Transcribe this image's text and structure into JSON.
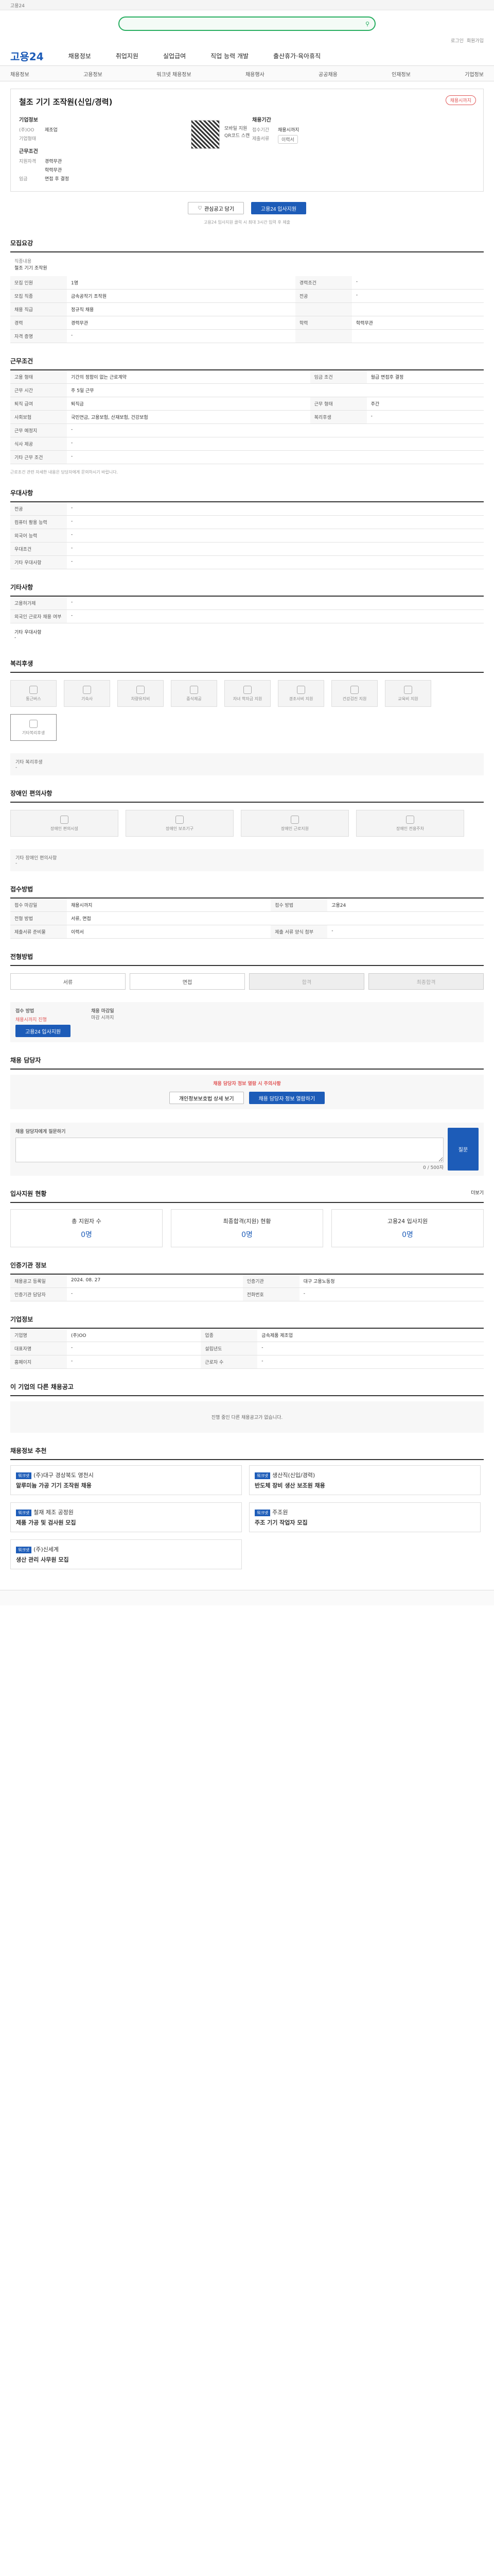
{
  "topbar": {
    "text": "고용24"
  },
  "search": {
    "placeholder": "",
    "label": "검색"
  },
  "userlinks": [
    "로그인",
    "회원가입"
  ],
  "gnb": {
    "logo": "고용24",
    "menus": [
      "채용정보",
      "취업지원",
      "실업급여",
      "직업 능력 개발",
      "출산휴가·육아휴직"
    ]
  },
  "lnb": [
    "채용정보",
    "고용정보",
    "워크넷 채용정보",
    "채용행사",
    "공공채용",
    "인재정보",
    "기업정보"
  ],
  "job": {
    "title": "철조 기기 조작원(신입/경력)",
    "badge": "채용시까지",
    "company_label": "기업정보",
    "company": [
      "(주)OO",
      "제조업",
      "기업형태"
    ],
    "cond_label": "근무조건",
    "cond": [
      "지원자격",
      "경력무관",
      "학력무관"
    ],
    "cond2": [
      "임금",
      "면접 후 결정",
      "근무지역"
    ],
    "qr_text": [
      "모바일 지원",
      "QR코드 스캔"
    ],
    "period_label": "채용기간",
    "period": [
      "접수기간",
      "채용시까지"
    ],
    "submit": [
      "제출서류",
      "이력서"
    ],
    "btn_interest": "관심공고 담기",
    "btn_apply": "고용24 입사지원",
    "notice": "고용24 입사지원 클릭 시 최대 3시간 입력 후 제출"
  },
  "qual": {
    "title": "모집요강",
    "label": "직종내용",
    "value": "철조 기기 조작원",
    "rows": [
      [
        "모집 인원",
        "1명",
        "경력조건",
        "-"
      ],
      [
        "모집 직종",
        "금속공작기 조작원",
        "전공",
        "-"
      ],
      [
        "채용 직급",
        "정규직 채용",
        "",
        ""
      ],
      [
        "경력",
        "경력무관",
        "학력",
        "학력무관"
      ],
      [
        "자격 증명",
        "-",
        "",
        ""
      ]
    ]
  },
  "cond": {
    "title": "근무조건",
    "rows": [
      [
        "고용 형태",
        "기간의 정함이 없는 근로계약",
        "임금 조건",
        "월급 면접후 결정"
      ],
      [
        "근무 시간",
        "주 5일 근무",
        "",
        ""
      ],
      [
        "퇴직 급여",
        "퇴직금",
        "근무 형태",
        "주간"
      ],
      [
        "사회보험",
        "국민연금, 고용보험, 산재보험, 건강보험",
        "복리후생",
        "-"
      ],
      [
        "근무 예정지",
        "-",
        "",
        ""
      ],
      [
        "식사 제공",
        "-",
        "",
        ""
      ],
      [
        "기타 근무 조건",
        "-",
        "",
        ""
      ]
    ],
    "note": "근로조건 관련 자세한 내용은 담당자에게 문의하시기 바랍니다."
  },
  "pref": {
    "title": "우대사항",
    "rows": [
      [
        "전공",
        "-"
      ],
      [
        "컴퓨터 활용 능력",
        "-"
      ],
      [
        "외국어 능력",
        "-"
      ],
      [
        "우대조건",
        "-"
      ],
      [
        "기타 우대사항",
        "-"
      ]
    ]
  },
  "etc": {
    "title": "기타사항",
    "rows": [
      [
        "고용허가제",
        "-"
      ],
      [
        "외국인 근로자 채용 여부",
        "-"
      ]
    ],
    "extra_label": "기타 우대사항",
    "extra_value": "-"
  },
  "welfare": {
    "title": "복리후생",
    "items": [
      "통근버스",
      "기숙사",
      "차량유지비",
      "중식제공",
      "자녀 학자금 지원",
      "경조사비 지원",
      "건강검진 지원",
      "교육비 지원",
      "기타복리후생"
    ],
    "extra_label": "기타 복리후생",
    "extra_value": "-"
  },
  "disab": {
    "title": "장애인 편의사항",
    "items": [
      "장애인 편의시설",
      "장애인 보조기구",
      "장애인 근로지원",
      "장애인 전용주차"
    ],
    "extra_label": "기타 장애인 편의사항",
    "extra_value": "-"
  },
  "apply": {
    "title": "접수방법",
    "rows": [
      [
        "접수 마감일",
        "채용시까지",
        "접수 방법",
        "고용24"
      ],
      [
        "전형 방법",
        "서류, 면접",
        "",
        ""
      ],
      [
        "제출서류 준비물",
        "이력서",
        "제출 서류 양식 첨부",
        "-"
      ]
    ]
  },
  "process": {
    "title": "전형방법",
    "steps": [
      "서류",
      "면접",
      "합격",
      "최종합격"
    ]
  },
  "reception": {
    "title": "접수 방법",
    "label": "채용시까지 진행",
    "btn": "고용24 입사지원",
    "label2": "채용 마감일",
    "label3": "마감 시까지"
  },
  "contact": {
    "title": "채용 담당자",
    "warning": "채용 담당자 정보 열람 시 주의사항",
    "btn1": "개인정보보호법 상세 보기",
    "btn2": "채용 담당자 정보 열람하기"
  },
  "inquiry": {
    "title": "채용 담당자에게 질문하기",
    "placeholder": "",
    "btn": "질문",
    "count": "0 / 500자"
  },
  "status": {
    "title": "입사지원 현황",
    "more": "더보기",
    "cards": [
      [
        "총 지원자 수",
        "0명"
      ],
      [
        "최종합격(지원) 현황",
        "0명"
      ],
      [
        "고용24 입사지원",
        "0명"
      ]
    ]
  },
  "agency": {
    "title": "인증기관 정보",
    "rows": [
      [
        "채용공고 등록일",
        "2024. 08. 27",
        "인증기관",
        "대구 고용노동청"
      ],
      [
        "인증기관 담당자",
        "-",
        "전화번호",
        "-"
      ]
    ]
  },
  "company": {
    "title": "기업정보",
    "rows": [
      [
        "기업명",
        "(주)OO",
        "업종",
        "금속제품 제조업"
      ],
      [
        "대표자명",
        "-",
        "설립년도",
        "-"
      ],
      [
        "홈페이지",
        "-",
        "근로자 수",
        "-"
      ]
    ]
  },
  "other": {
    "title": "이 기업의 다른 채용공고",
    "empty": "진행 중인 다른 채용공고가 없습니다."
  },
  "recommend": {
    "title": "채용정보 추천",
    "cards": [
      [
        "워크넷",
        "(주)대구 경상북도 영천시",
        "알루미늄 가공 기기 조작원 채용"
      ],
      [
        "워크넷",
        "생산직(신입/경력)",
        "반도체 장비 생산 보조원 채용"
      ],
      [
        "워크넷",
        "철재 제조 공정원",
        "제품 가공 및 검사원 모집"
      ],
      [
        "워크넷",
        "주조원",
        "주조 기기 작업자 모집"
      ],
      [
        "워크넷",
        "(주)신세계",
        "생산 관리 사무원 모집"
      ]
    ]
  }
}
